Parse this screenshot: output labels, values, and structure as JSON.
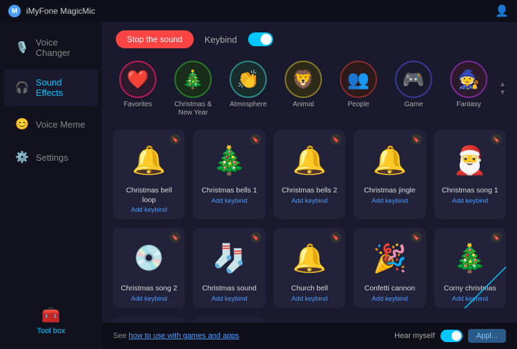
{
  "app": {
    "title": "iMyFone MagicMic",
    "user_icon": "👤"
  },
  "sidebar": {
    "items": [
      {
        "id": "voice-changer",
        "label": "Voice Changer",
        "icon": "🎙️",
        "active": false
      },
      {
        "id": "sound-effects",
        "label": "Sound Effects",
        "icon": "🎧",
        "active": true
      },
      {
        "id": "voice-meme",
        "label": "Voice Meme",
        "icon": "😊",
        "active": false
      },
      {
        "id": "settings",
        "label": "Settings",
        "icon": "⚙️",
        "active": false
      }
    ],
    "toolbox": {
      "label": "Tool box",
      "icon": "🧰"
    }
  },
  "controls": {
    "stop_sound_label": "Stop the sound",
    "keybind_label": "Keybind",
    "keybind_enabled": true
  },
  "categories": [
    {
      "id": "favorites",
      "label": "Favorites",
      "icon": "❤️",
      "style": "cat-favorites"
    },
    {
      "id": "christmas",
      "label": "Christmas & New Year",
      "icon": "🎄",
      "style": "cat-christmas"
    },
    {
      "id": "atmosphere",
      "label": "Atmosphere",
      "icon": "👏",
      "style": "cat-atmosphere"
    },
    {
      "id": "animal",
      "label": "Animal",
      "icon": "🦁",
      "style": "cat-animal"
    },
    {
      "id": "people",
      "label": "People",
      "icon": "👥",
      "style": "cat-people"
    },
    {
      "id": "game",
      "label": "Game",
      "icon": "🎮",
      "style": "cat-game"
    },
    {
      "id": "fantasy",
      "label": "Fantasy",
      "icon": "🧙",
      "style": "cat-fantasy"
    }
  ],
  "sounds": [
    {
      "id": "christmas-bell-loop",
      "name": "Christmas bell loop",
      "keybind": "Add keybind",
      "icon": "🔔",
      "bg": "#ffa500"
    },
    {
      "id": "christmas-bells-1",
      "name": "Christmas bells 1",
      "keybind": "Add keybind",
      "icon": "🎄",
      "bg": "#cc0000"
    },
    {
      "id": "christmas-bells-2",
      "name": "Christmas bells 2",
      "keybind": "Add keybind",
      "icon": "🔔",
      "bg": "#cc3333"
    },
    {
      "id": "christmas-jingle",
      "name": "Christmas jingle",
      "keybind": "Add keybind",
      "icon": "🔔",
      "bg": "#ffaa00"
    },
    {
      "id": "christmas-song-1",
      "name": "Christmas song 1",
      "keybind": "Add keybind",
      "icon": "🎅",
      "bg": "#cc0000"
    },
    {
      "id": "christmas-song-2",
      "name": "Christmas song 2",
      "keybind": "Add keybind",
      "icon": "💿",
      "bg": "#333"
    },
    {
      "id": "christmas-sound",
      "name": "Christmas sound",
      "keybind": "Add keybind",
      "icon": "🧦",
      "bg": "#cc2200"
    },
    {
      "id": "church-bell",
      "name": "Church bell",
      "keybind": "Add keybind",
      "icon": "🔔",
      "bg": "#888800"
    },
    {
      "id": "confetti-cannon",
      "name": "Confetti cannon",
      "keybind": "Add keybind",
      "icon": "🎉",
      "bg": "#004488"
    },
    {
      "id": "corny-christmas",
      "name": "Corny christmas",
      "keybind": "Add keybind",
      "icon": "🎄",
      "bg": "#006600"
    },
    {
      "id": "sound-11",
      "name": "",
      "keybind": "",
      "icon": "🎵",
      "bg": "#333"
    },
    {
      "id": "sound-12",
      "name": "",
      "keybind": "",
      "icon": "🎵",
      "bg": "#333"
    }
  ],
  "bottom_bar": {
    "see_text": "See ",
    "link_text": "how to use with games and apps",
    "hear_myself_label": "Hear myself",
    "apply_label": "Appl..."
  }
}
